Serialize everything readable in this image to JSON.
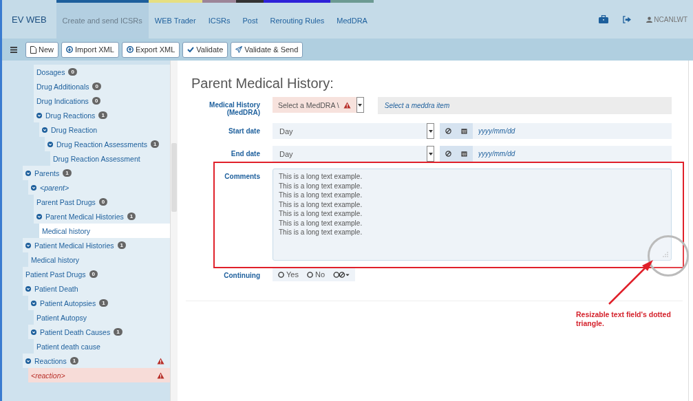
{
  "nav": {
    "brand": "EV WEB",
    "tabs": [
      {
        "label": "Create and send ICSRs",
        "selected": true,
        "color": "#1d5f9c"
      },
      {
        "label": "WEB Trader",
        "selected": false,
        "color": "#e6df82"
      },
      {
        "label": "ICSRs",
        "selected": false,
        "color": "#9c8598"
      },
      {
        "label": "Post",
        "selected": false,
        "color": "#333333"
      },
      {
        "label": "Rerouting Rules",
        "selected": false,
        "color": "#2e22d8"
      },
      {
        "label": "MedDRA",
        "selected": false,
        "color": "#6c9a92"
      }
    ],
    "user": "NCANLWT"
  },
  "toolbar": {
    "buttons": [
      {
        "kind": "new",
        "label": "New"
      },
      {
        "kind": "import",
        "label": "Import XML"
      },
      {
        "kind": "export",
        "label": "Export XML"
      },
      {
        "kind": "validate",
        "label": "Validate"
      },
      {
        "kind": "send",
        "label": "Validate & Send"
      }
    ]
  },
  "tree": {
    "continued": [
      {
        "label": "Dosages",
        "count": "0"
      },
      {
        "label": "Drug Additionals",
        "count": "0"
      },
      {
        "label": "Drug Indications",
        "count": "0"
      },
      {
        "label": "Drug Reactions",
        "count": "1",
        "expanded": true,
        "children": [
          {
            "label": "Drug Reaction",
            "expanded": true,
            "children": [
              {
                "label": "Drug Reaction Assessments",
                "count": "1",
                "expanded": true,
                "children": [
                  {
                    "label": "Drug Reaction Assessment"
                  }
                ]
              }
            ]
          }
        ]
      }
    ],
    "items": [
      {
        "label": "Parents",
        "count": "1",
        "expanded": true,
        "children": [
          {
            "label": "<parent>",
            "kind": "instance",
            "expanded": true,
            "children": [
              {
                "label": "Parent Past Drugs",
                "count": "0"
              },
              {
                "label": "Parent Medical Histories",
                "count": "1",
                "expanded": true,
                "children": [
                  {
                    "label": "Medical history",
                    "selected": true
                  }
                ]
              }
            ]
          }
        ]
      },
      {
        "label": "Patient Medical Histories",
        "count": "1",
        "expanded": true,
        "children": [
          {
            "label": "Medical history",
            "selected": false
          }
        ]
      },
      {
        "label": "Patient Past Drugs",
        "count": "0"
      },
      {
        "label": "Patient Death",
        "expanded": true,
        "children": [
          {
            "label": "Patient Autopsies",
            "count": "1",
            "expanded": true,
            "children": [
              {
                "label": "Patient Autopsy"
              }
            ]
          },
          {
            "label": "Patient Death Causes",
            "count": "1",
            "expanded": true,
            "children": [
              {
                "label": "Patient death cause"
              }
            ]
          }
        ]
      },
      {
        "label": "Reactions",
        "count": "1",
        "warning": true,
        "expanded": true,
        "children": [
          {
            "label": "<reaction>",
            "kind": "instance",
            "error": true,
            "warning": true
          }
        ]
      }
    ]
  },
  "form": {
    "title": "Parent Medical History:",
    "meddra": {
      "label": "Medical History (MedDRA)",
      "select": "Select a MedDRA \\",
      "placeholder": "Select a meddra item",
      "warning": true
    },
    "dates": [
      {
        "label": "Start date",
        "unit": "Day",
        "placeholder": "yyyy/mm/dd"
      },
      {
        "label": "End date",
        "unit": "Day",
        "placeholder": "yyyy/mm/dd"
      }
    ],
    "comments": {
      "label": "Comments",
      "lines": [
        "This is a long text example.",
        "This is a long text example.",
        "This is a long text example.",
        "This is a long text example.",
        "This is a long text example.",
        "This is a long text example.",
        "This is a long text example."
      ]
    },
    "continuing": {
      "label": "Continuing",
      "options": [
        {
          "label": "Yes",
          "selected": false
        },
        {
          "label": "No",
          "selected": false
        }
      ]
    }
  },
  "annotation": {
    "note": "Resizable text field's dotted triangle."
  }
}
